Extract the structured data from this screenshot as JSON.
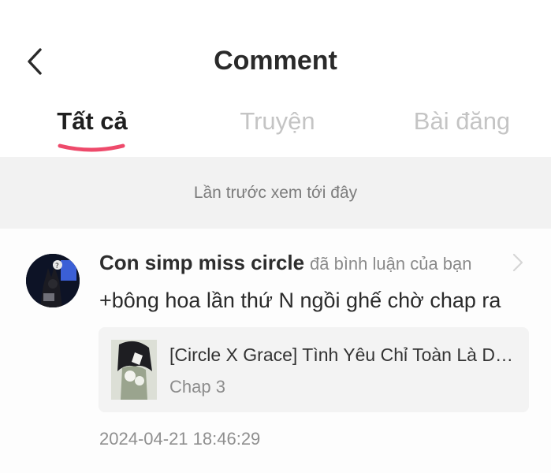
{
  "header": {
    "title": "Comment",
    "back_icon": "chevron-left-icon"
  },
  "tabs": [
    {
      "label": "Tất cả",
      "active": true
    },
    {
      "label": "Truyện",
      "active": false
    },
    {
      "label": "Bài đăng",
      "active": false
    }
  ],
  "colors": {
    "tab_indicator": "#ee4a6b",
    "band_background": "#f2f2f2",
    "card_background": "#f3f3f3"
  },
  "divider_text": "Lần trước xem tới đây",
  "comment": {
    "author": "Con simp miss circle",
    "action": "đã bình luận của bạn",
    "text": "+bông hoa lần thứ N ngồi ghế chờ chap ra",
    "card": {
      "title": "[Circle X Grace] Tình Yêu Chỉ Toàn Là Dối Trá",
      "chapter": "Chap 3"
    },
    "timestamp": "2024-04-21 18:46:29",
    "chevron_icon": "chevron-right-icon"
  }
}
